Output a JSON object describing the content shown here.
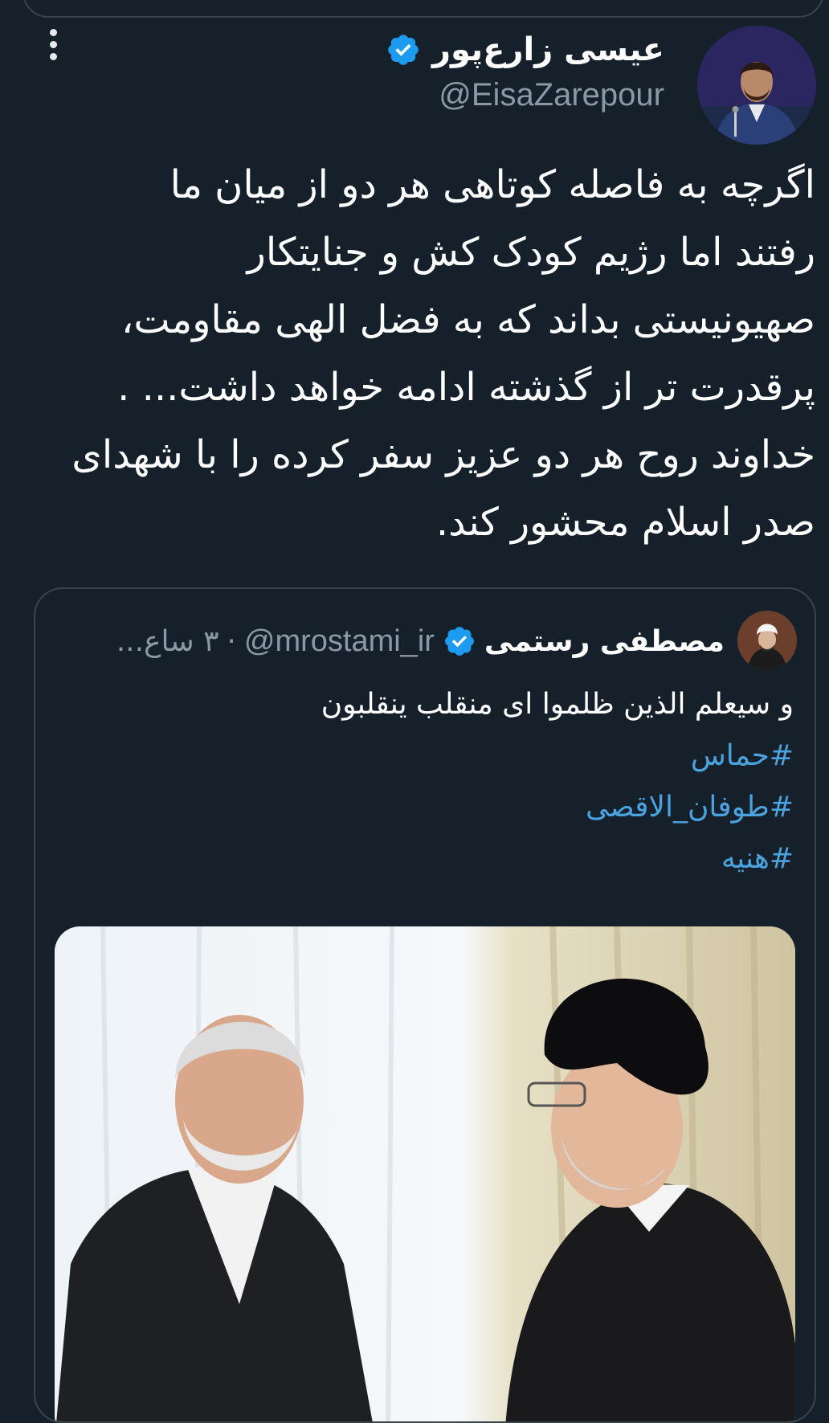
{
  "tweet": {
    "author": {
      "display_name": "عیسی زارع‌پور",
      "handle": "@EisaZarepour",
      "verified": true
    },
    "text": "اگرچه به فاصله کوتاهی هر دو از میان ما\nرفتند اما رژیم کودک کش و جنایتکار\nصهیونیستی بداند که به فضل الهی مقاومت،\nپرقدرت تر از گذشته ادامه خواهد داشت... .\nخداوند روح هر دو عزیز سفر کرده را با شهدای\nصدر اسلام محشور کند."
  },
  "quoted_tweet": {
    "author": {
      "display_name": "مصطفی رستمی",
      "handle": "@mrostami_ir",
      "verified": true
    },
    "separator": "·",
    "time": "۳ ساع...",
    "text": "و سیعلم الذین ظلموا ای منقلب ینقلبون",
    "hashtags": [
      "#حماس",
      "#طوفان_الاقصی",
      "#هنیه"
    ]
  },
  "colors": {
    "background": "#15202b",
    "border": "#38444d",
    "secondary_text": "#8b98a5",
    "hashtag": "#4aa3df",
    "verified_badge": "#1d9bf0"
  },
  "icons": {
    "more": "more-vertical-icon",
    "verified": "verified-badge-icon"
  }
}
